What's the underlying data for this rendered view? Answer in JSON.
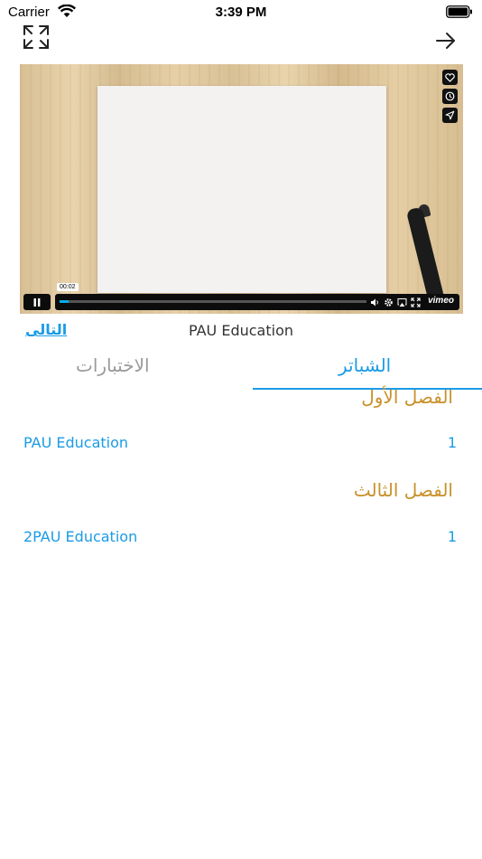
{
  "status_bar": {
    "carrier": "Carrier",
    "time": "3:39 PM"
  },
  "nav": {
    "expand_icon": "expand-icon",
    "back_icon": "arrow-right-icon"
  },
  "video": {
    "timestamp": "00:02",
    "progress": 0.03,
    "brand": "vimeo",
    "side_icons": [
      "heart-icon",
      "clock-icon",
      "send-icon"
    ],
    "control_icons": [
      "volume-icon",
      "gear-icon",
      "airplay-icon",
      "fullscreen-icon"
    ]
  },
  "title_row": {
    "video_title": "PAU Education",
    "next_label": "التالى"
  },
  "tabs": [
    {
      "label": "الشباتر",
      "active": true
    },
    {
      "label": "الاختبارات",
      "active": false
    }
  ],
  "sections": [
    {
      "title": "الفصل الأول",
      "lessons": [
        {
          "name": "PAU Education",
          "number": "1"
        }
      ]
    },
    {
      "title": "الفصل الثالث",
      "lessons": [
        {
          "name": "2PAU Education",
          "number": "1"
        }
      ]
    }
  ],
  "colors": {
    "accent": "#1a9be6",
    "section_title": "#c8912a",
    "inactive_tab": "#9a9a9a"
  }
}
